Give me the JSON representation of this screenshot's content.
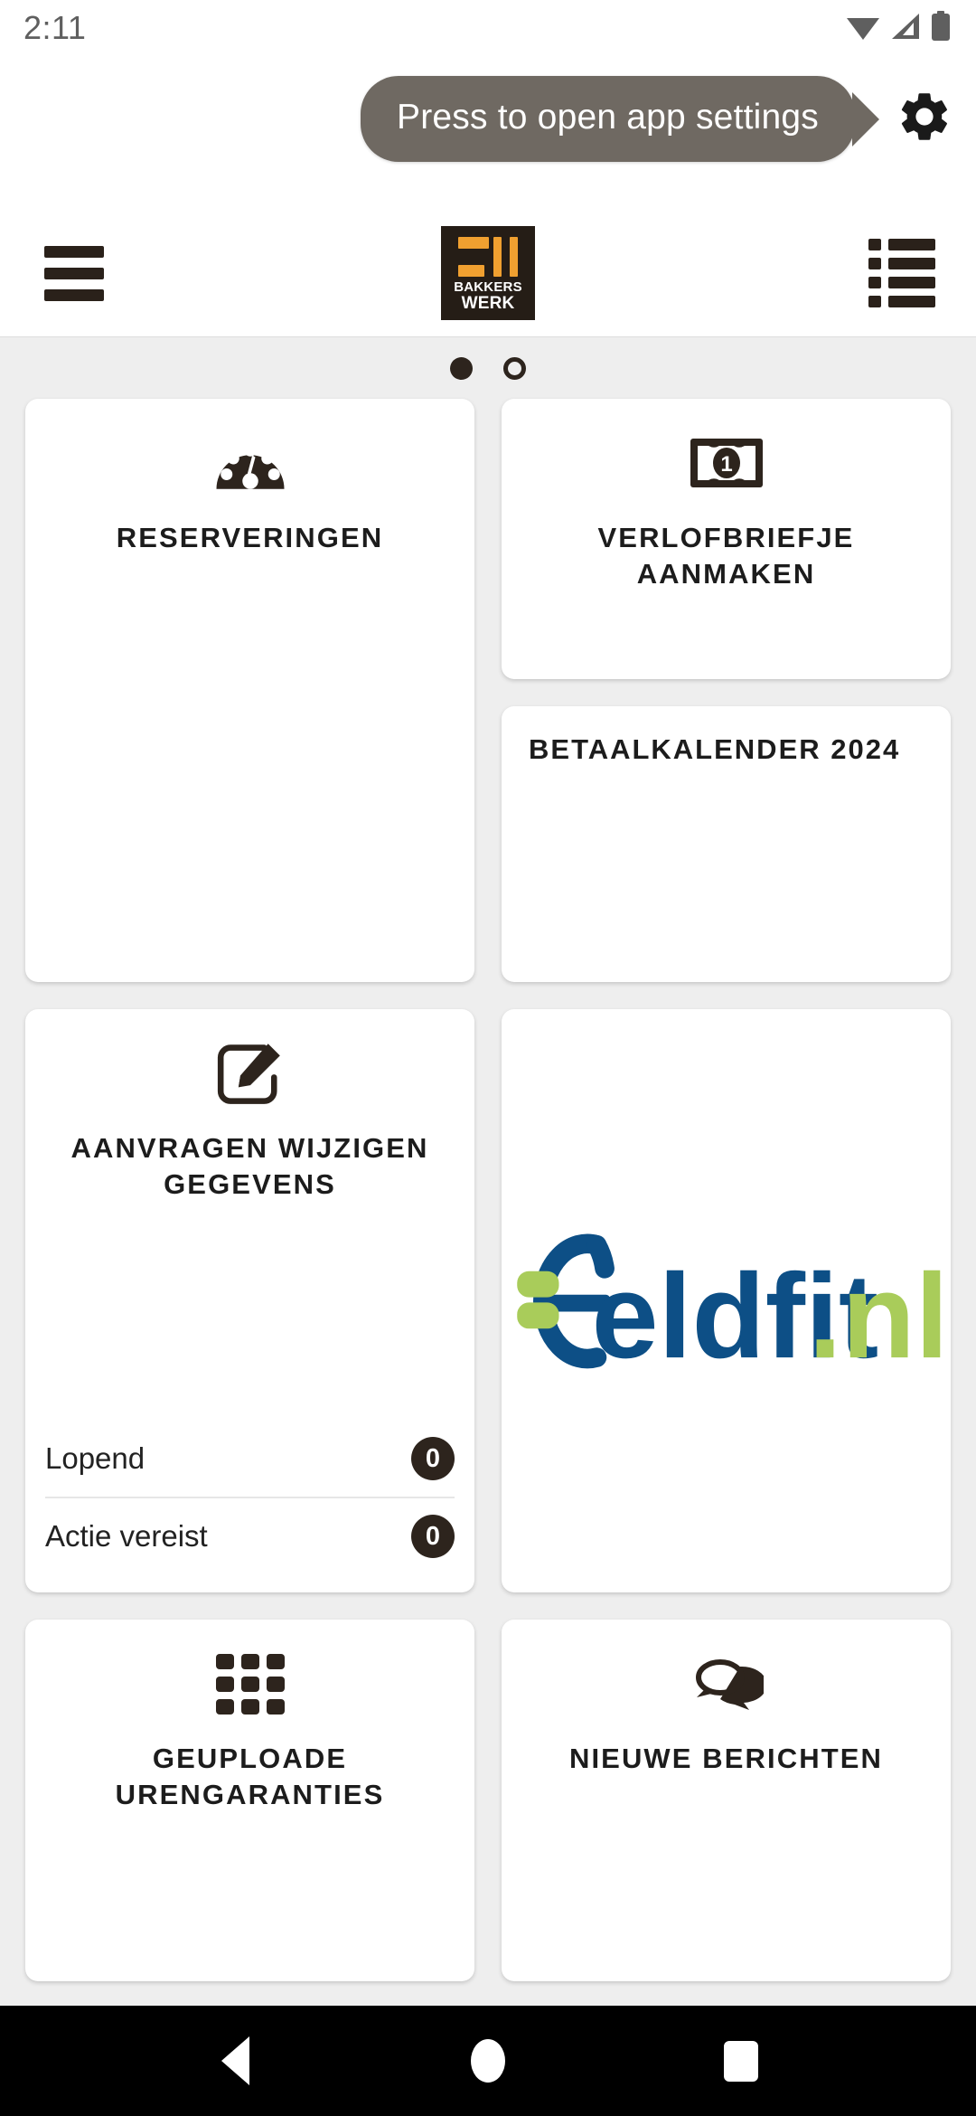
{
  "status_bar": {
    "time": "2:11",
    "icons": [
      "wifi-icon",
      "cellular-signal-icon",
      "battery-icon"
    ]
  },
  "tooltip": {
    "text": "Press to open app settings",
    "background_color": "#6f6962",
    "text_color": "#ffffff",
    "target_icon": "gear-icon"
  },
  "toolbar": {
    "menu_icon": "hamburger-menu-icon",
    "list_icon": "list-view-icon",
    "logo": {
      "line1": "BAKKERS",
      "line2": "WERK",
      "background_color": "#251d16",
      "accent_color": "#f0a030"
    }
  },
  "pager": {
    "total": 2,
    "active_index": 0
  },
  "cards": {
    "reserveringen": {
      "title": "RESERVERINGEN",
      "icon": "speedometer-icon"
    },
    "verlofbriefje": {
      "title": "VERLOFBRIEFJE AANMAKEN",
      "icon": "banknote-icon",
      "banknote_value": "1"
    },
    "betaalkalender": {
      "title": "BETAALKALENDER 2024"
    },
    "aanvragen": {
      "title": "AANVRAGEN WIJZIGEN GEGEVENS",
      "icon": "edit-pencil-icon",
      "stats": [
        {
          "label": "Lopend",
          "value": "0"
        },
        {
          "label": "Actie vereist",
          "value": "0"
        }
      ]
    },
    "geldfit": {
      "logo_text": "Geldfit",
      "logo_suffix": ".nl",
      "blue": "#0d4f86",
      "green": "#a9cc5a"
    },
    "urengaranties": {
      "title": "GEUPLOADE URENGARANTIES",
      "icon": "grid-3x3-icon"
    },
    "berichten": {
      "title": "NIEUWE BERICHTEN",
      "icon": "chat-bubbles-icon"
    }
  },
  "navigation_bar": {
    "back": "back-button",
    "home": "home-button",
    "recents": "recents-button"
  }
}
